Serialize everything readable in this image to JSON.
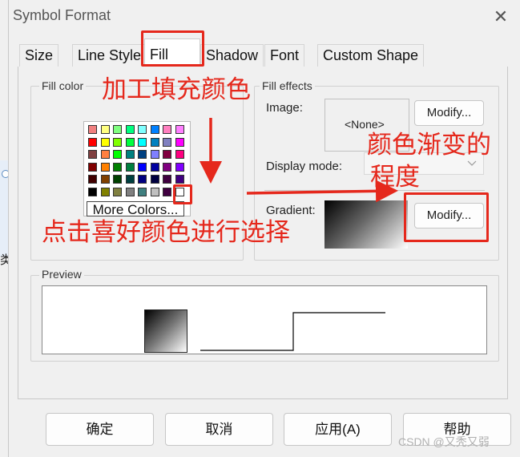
{
  "window": {
    "title": "Symbol Format",
    "close_glyph": "✕"
  },
  "left_edge_text": "类",
  "tabs": [
    {
      "label": "Size"
    },
    {
      "label": "Line Style"
    },
    {
      "label": "Fill"
    },
    {
      "label": "Shadow"
    },
    {
      "label": "Font"
    },
    {
      "label": "Custom Shape"
    }
  ],
  "fill_color": {
    "label": "Fill color",
    "more_colors_label": "More Colors...",
    "palette_rows": [
      [
        "#f08080",
        "#ffff80",
        "#80ff80",
        "#00ff80",
        "#80ffff",
        "#0080ff",
        "#ff80c0",
        "#ff80ff"
      ],
      [
        "#ff0000",
        "#ffff00",
        "#80ff00",
        "#00ff40",
        "#00ffff",
        "#0080c0",
        "#8080c0",
        "#ff00ff"
      ],
      [
        "#804040",
        "#ff8040",
        "#00ff00",
        "#008080",
        "#004080",
        "#8080ff",
        "#800040",
        "#ff0080"
      ],
      [
        "#800000",
        "#ff8000",
        "#008000",
        "#008040",
        "#0000ff",
        "#0000a0",
        "#800080",
        "#8000ff"
      ],
      [
        "#400000",
        "#804000",
        "#004000",
        "#004040",
        "#000080",
        "#000040",
        "#400040",
        "#400080"
      ],
      [
        "#000000",
        "#808000",
        "#808040",
        "#808080",
        "#408080",
        "#c0c0c0",
        "#400040",
        "#ffffff"
      ]
    ]
  },
  "fill_effects": {
    "label": "Fill effects",
    "image_label": "Image:",
    "image_value": "<None>",
    "image_modify": "Modify...",
    "display_mode_label": "Display mode:",
    "display_mode_value": "",
    "gradient_label": "Gradient:",
    "gradient_modify": "Modify..."
  },
  "preview": {
    "label": "Preview"
  },
  "buttons": {
    "ok": "确定",
    "cancel": "取消",
    "apply": "应用(A)",
    "help": "帮助"
  },
  "annotations": {
    "fill_color_note": "加工填充颜色",
    "pick_color_note": "点击喜好颜色进行选择",
    "gradient_note_line1": "颜色渐变的",
    "gradient_note_line2": "程度"
  },
  "watermark": "CSDN @又秃又弱",
  "colors": {
    "annotation_red": "#e5281c"
  }
}
